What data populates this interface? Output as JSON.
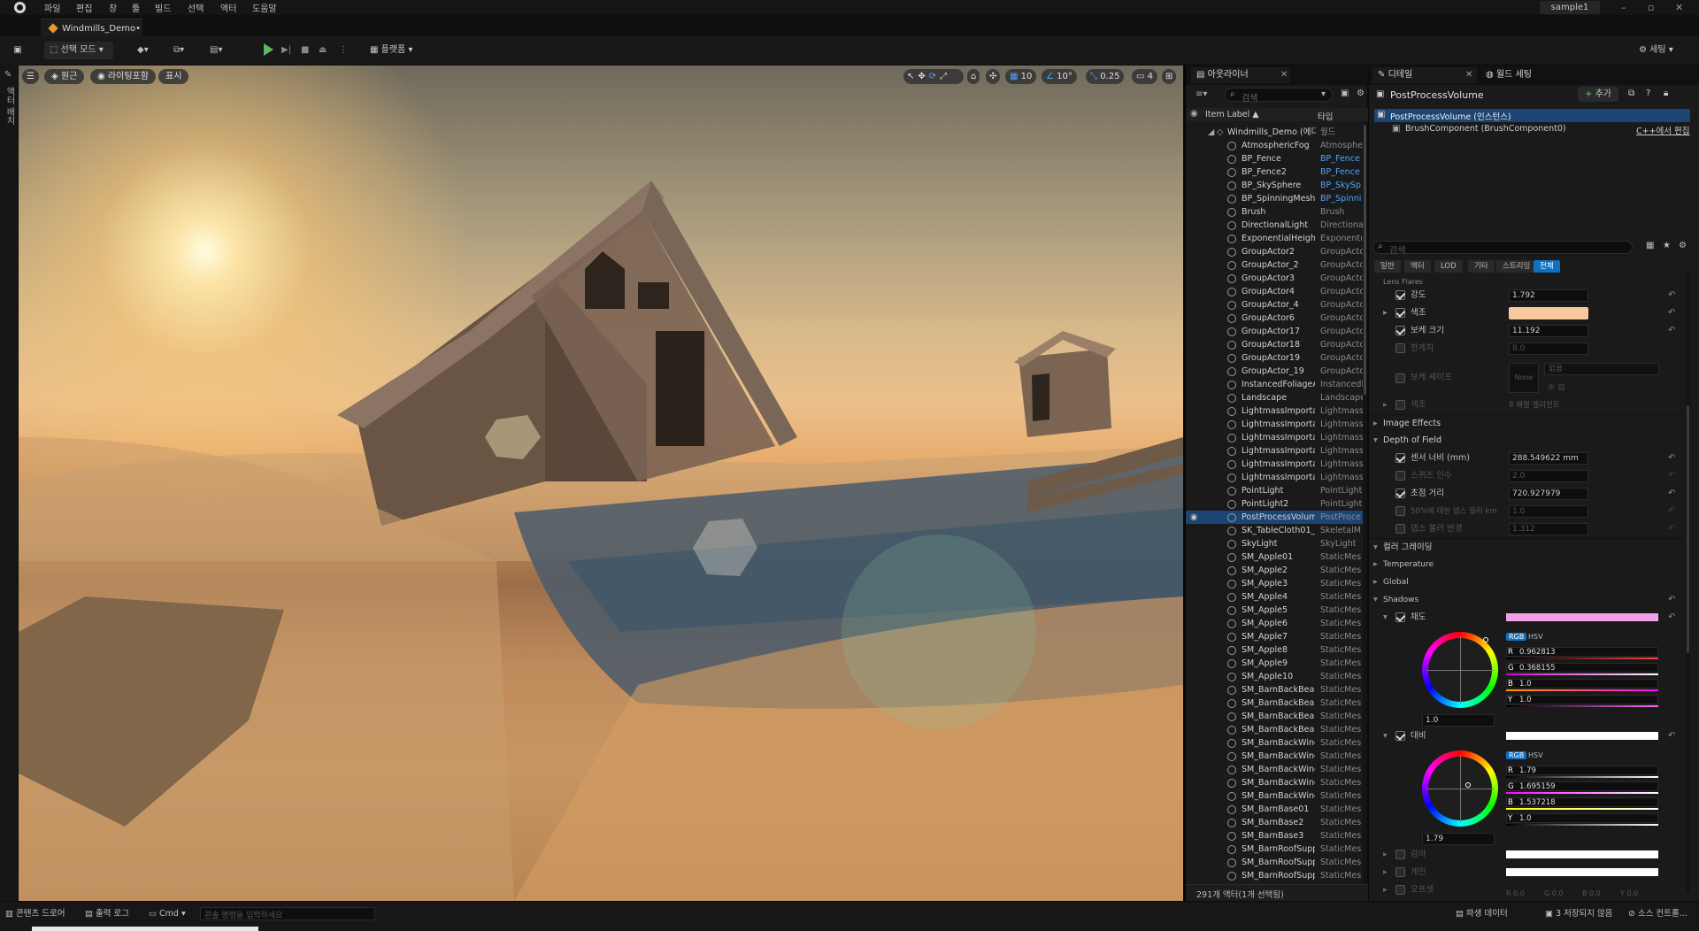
{
  "menubar": {
    "items": [
      "파일",
      "편집",
      "창",
      "툴",
      "빌드",
      "선택",
      "액터",
      "도움말"
    ],
    "project_name": "sample1",
    "window_controls": [
      "minimize-icon",
      "maximize-icon",
      "close-icon"
    ]
  },
  "doc_tab": {
    "label": "Windmills_Demo•"
  },
  "toolbar": {
    "mode_label": "선택 모드",
    "platforms_label": "플랫폼",
    "settings_label": "세팅"
  },
  "left_strip": {
    "label": "액터 배치"
  },
  "viewport": {
    "perspective": "원근",
    "lighting": "라이팅포함",
    "show": "표시",
    "grid_snap": "10",
    "rot_snap": "10°",
    "scale_snap": "0.25",
    "camera_speed": "4"
  },
  "outliner": {
    "tab": "아웃라이너",
    "search_placeholder": "검색",
    "col_label": "Item Label ▲",
    "col_type": "타입",
    "root": {
      "label": "Windmills_Demo (에디",
      "type": "월드"
    },
    "rows": [
      {
        "label": "AtmosphericFog",
        "type": "Atmosphe"
      },
      {
        "label": "BP_Fence",
        "type": "BP_Fence"
      },
      {
        "label": "BP_Fence2",
        "type": "BP_Fence"
      },
      {
        "label": "BP_SkySphere",
        "type": "BP_SkySp"
      },
      {
        "label": "BP_SpinningMesh",
        "type": "BP_Spinni"
      },
      {
        "label": "Brush",
        "type": "Brush"
      },
      {
        "label": "DirectionalLight",
        "type": "Directiona"
      },
      {
        "label": "ExponentialHeightF",
        "type": "Exponentı"
      },
      {
        "label": "GroupActor2",
        "type": "GroupActc"
      },
      {
        "label": "GroupActor_2",
        "type": "GroupActc"
      },
      {
        "label": "GroupActor3",
        "type": "GroupActc"
      },
      {
        "label": "GroupActor4",
        "type": "GroupActc"
      },
      {
        "label": "GroupActor_4",
        "type": "GroupActc"
      },
      {
        "label": "GroupActor6",
        "type": "GroupActc"
      },
      {
        "label": "GroupActor17",
        "type": "GroupActc"
      },
      {
        "label": "GroupActor18",
        "type": "GroupActc"
      },
      {
        "label": "GroupActor19",
        "type": "GroupActc"
      },
      {
        "label": "GroupActor_19",
        "type": "GroupActc"
      },
      {
        "label": "InstancedFoliageAc",
        "type": "Instancedl"
      },
      {
        "label": "Landscape",
        "type": "Landscape"
      },
      {
        "label": "LightmassImportan",
        "type": "Lightmass"
      },
      {
        "label": "LightmassImportan",
        "type": "Lightmass"
      },
      {
        "label": "LightmassImportan",
        "type": "Lightmass"
      },
      {
        "label": "LightmassImportan",
        "type": "Lightmass"
      },
      {
        "label": "LightmassImportan",
        "type": "Lightmass"
      },
      {
        "label": "LightmassImportan",
        "type": "Lightmass"
      },
      {
        "label": "PointLight",
        "type": "PointLight"
      },
      {
        "label": "PointLight2",
        "type": "PointLight"
      },
      {
        "label": "PostProcessVolum",
        "type": "PostProce"
      },
      {
        "label": "SK_TableCloth01_P",
        "type": "SkeletalM"
      },
      {
        "label": "SkyLight",
        "type": "SkyLight"
      },
      {
        "label": "SM_Apple01",
        "type": "StaticMes"
      },
      {
        "label": "SM_Apple2",
        "type": "StaticMes"
      },
      {
        "label": "SM_Apple3",
        "type": "StaticMes"
      },
      {
        "label": "SM_Apple4",
        "type": "StaticMes"
      },
      {
        "label": "SM_Apple5",
        "type": "StaticMes"
      },
      {
        "label": "SM_Apple6",
        "type": "StaticMes"
      },
      {
        "label": "SM_Apple7",
        "type": "StaticMes"
      },
      {
        "label": "SM_Apple8",
        "type": "StaticMes"
      },
      {
        "label": "SM_Apple9",
        "type": "StaticMes"
      },
      {
        "label": "SM_Apple10",
        "type": "StaticMes"
      },
      {
        "label": "SM_BarnBackBeam",
        "type": "StaticMes"
      },
      {
        "label": "SM_BarnBackBeam",
        "type": "StaticMes"
      },
      {
        "label": "SM_BarnBackBeam",
        "type": "StaticMes"
      },
      {
        "label": "SM_BarnBackBeam",
        "type": "StaticMes"
      },
      {
        "label": "SM_BarnBackWind",
        "type": "StaticMes"
      },
      {
        "label": "SM_BarnBackWind",
        "type": "StaticMes"
      },
      {
        "label": "SM_BarnBackWind",
        "type": "StaticMes"
      },
      {
        "label": "SM_BarnBackWind",
        "type": "StaticMes"
      },
      {
        "label": "SM_BarnBackWind",
        "type": "StaticMes"
      },
      {
        "label": "SM_BarnBase01",
        "type": "StaticMes"
      },
      {
        "label": "SM_BarnBase2",
        "type": "StaticMes"
      },
      {
        "label": "SM_BarnBase3",
        "type": "StaticMes"
      },
      {
        "label": "SM_BarnRoofSuppc",
        "type": "StaticMes"
      },
      {
        "label": "SM_BarnRoofSuppc",
        "type": "StaticMes"
      },
      {
        "label": "SM_BarnRoofSuppc",
        "type": "StaticMes"
      }
    ],
    "footer": "291개 액터(1개 선택됨)"
  },
  "details": {
    "tab_details": "디테일",
    "tab_world": "월드 세팅",
    "actor_name": "PostProcessVolume",
    "add_label": "추가",
    "component_root": "PostProcessVolume (인스턴스)",
    "component_child": "BrushComponent (BrushComponent0)",
    "cpp_edit": "C++에서 편집",
    "search_placeholder": "검색",
    "filters": [
      "일반",
      "액터",
      "LOD",
      "기타",
      "스트리밍",
      "전체"
    ],
    "lens_flares": {
      "header": "Lens Flares",
      "intensity_label": "강도",
      "intensity": "1.792",
      "tint_label": "색조",
      "bokeh_size_label": "보케 크기",
      "bokeh_size": "11.192",
      "threshold_label": "한계치",
      "threshold": "8.0",
      "bokeh_shape_label": "보케 셰이프",
      "bokeh_shape_none": "None",
      "bokeh_shape_dropdown": "없음",
      "tints_label": "색조",
      "tints_value": "8 배열 엘리먼트"
    },
    "image_effects": "Image Effects",
    "dof": {
      "header": "Depth of Field",
      "sensor_label": "센서 너비 (mm)",
      "sensor": "288.549622 mm",
      "squeeze_label": "스퀴즈 인수",
      "squeeze": "2.0",
      "focal_label": "초점 거리",
      "focal": "720.927979",
      "depth_blur_label": "50%에 대한 뎁스 블러 km",
      "depth_blur": "1.0",
      "depth_radius_label": "뎁스 블러 반경",
      "depth_radius": "1.312"
    },
    "color_grading": "컬러 그레이딩",
    "temperature": "Temperature",
    "global": "Global",
    "shadows": "Shadows",
    "saturation": {
      "label": "채도",
      "rgb": "RGB",
      "hsv": "HSV",
      "r": "0.962813",
      "g": "0.368155",
      "b": "1.0",
      "y": "1.0",
      "wheel_value": "1.0"
    },
    "contrast": {
      "label": "대비",
      "rgb": "RGB",
      "hsv": "HSV",
      "r": "1.79",
      "g": "1.695159",
      "b": "1.537218",
      "y": "1.0",
      "wheel_value": "1.79"
    },
    "gamma": "감마",
    "gain": "게인",
    "offset": "오프셋",
    "offset_values": [
      "0.0",
      "0.0",
      "0.0",
      "0.0"
    ],
    "colors": {
      "tint": "#f8c89e",
      "sat_bar": "#f4a0e8",
      "contrast_bar": "#ffffff",
      "accent": "#0e70c0"
    }
  },
  "statusbar": {
    "content_drawer": "콘텐츠 드로어",
    "output_log": "출력 로그",
    "cmd": "Cmd",
    "console_placeholder": "콘솔 명령을 입력하세요",
    "derived_data": "파생 데이터",
    "unsaved": "3 저장되지 않음",
    "source_control": "소스 컨트롤..."
  }
}
